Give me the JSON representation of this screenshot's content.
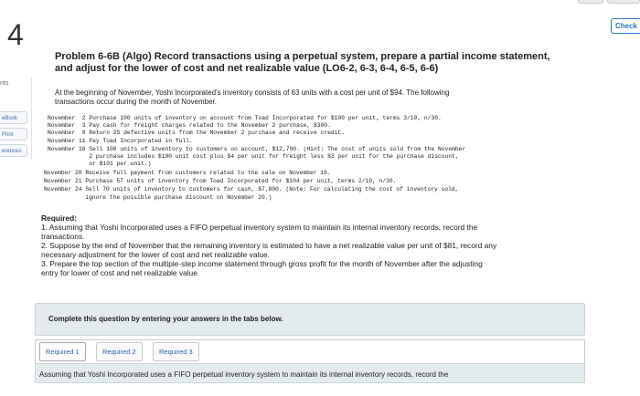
{
  "header": {
    "question_number": "4",
    "check_label": "Check"
  },
  "sidebar": {
    "points_label": "nts",
    "items": [
      {
        "label": "eBook"
      },
      {
        "label": "Print"
      },
      {
        "label": "erences"
      }
    ]
  },
  "problem": {
    "title_line1": "Problem 6-6B (Algo) Record transactions using a perpetual system, prepare a partial income statement,",
    "title_line2": "and adjust for the lower of cost and net realizable value (LO6-2, 6-3, 6-4, 6-5, 6-6)",
    "intro_line1": "At the beginning of November, Yoshi Incorporated's inventory consists of 63 units with a cost per unit of $94. The following",
    "intro_line2": "transactions occur during the month of November.",
    "transactions": [
      "November  2 Purchase 100 units of inventory on account from Toad Incorporated for $100 per unit, terms 3/10, n/30.",
      "November  3 Pay cash for freight charges related to the November 2 purchase, $300.",
      "November  9 Return 25 defective units from the November 2 purchase and receive credit.",
      "November 11 Pay Toad Incorporated in full.",
      "November 16 Sell 100 units of inventory to customers on account, $12,700. (Hint: The cost of units sold from the November",
      "            2 purchase includes $100 unit cost plus $4 per unit for freight less $3 per unit for the purchase discount,",
      "            or $101 per unit.)",
      "November 20 Receive full payment from customers related to the sale on November 16.",
      "November 21 Purchase 57 units of inventory from Toad Incorporated for $104 per unit, terms 2/10, n/30.",
      "November 24 Sell 70 units of inventory to customers for cash, $7,800. (Note: For calculating the cost of inventory sold,",
      "            ignore the possible purchase discount on November 20.)"
    ]
  },
  "required": {
    "heading": "Required:",
    "line1a": "1. Assuming that Yoshi Incorporated uses a FIFO perpetual inventory system to maintain its internal inventory records, record the",
    "line1b": "transactions.",
    "line2a": "2. Suppose by the end of November that the remaining inventory is estimated to have a net realizable value per unit of $81, record any",
    "line2b": "necessary adjustment for the lower of cost and net realizable value.",
    "line3a": "3. Prepare the top section of the multiple-step income statement through gross profit for the month of November after the adjusting",
    "line3b": "entry for lower of cost and net realizable value."
  },
  "complete_instruction": "Complete this question by entering your answers in the tabs below.",
  "tabs": [
    {
      "label": "Required 1"
    },
    {
      "label": "Required 2"
    },
    {
      "label": "Required 3"
    }
  ],
  "assumption_text": "Assuming that Yoshi Incorporated uses a FIFO perpetual inventory system to maintain its internal inventory records, record the"
}
